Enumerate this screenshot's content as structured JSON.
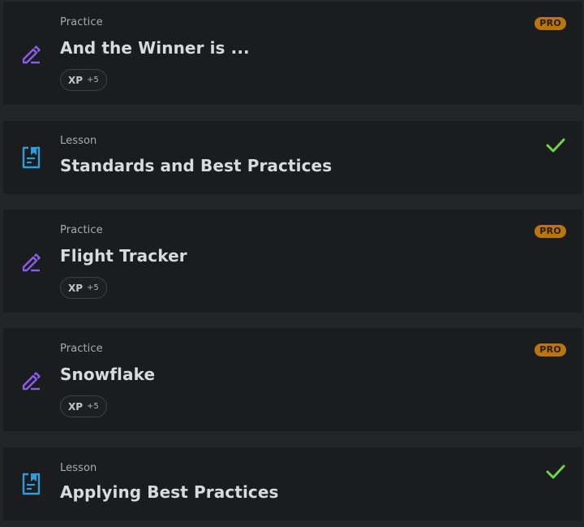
{
  "items": [
    {
      "type": "Practice",
      "title": "And the Winner is ...",
      "badge": "PRO",
      "xp_label": "XP",
      "xp_value": "+5",
      "icon": "pencil-icon"
    },
    {
      "type": "Lesson",
      "title": "Standards and Best Practices",
      "status": "completed",
      "icon": "lesson-document-icon"
    },
    {
      "type": "Practice",
      "title": "Flight Tracker",
      "badge": "PRO",
      "xp_label": "XP",
      "xp_value": "+5",
      "icon": "pencil-icon"
    },
    {
      "type": "Practice",
      "title": "Snowflake",
      "badge": "PRO",
      "xp_label": "XP",
      "xp_value": "+5",
      "icon": "pencil-icon"
    },
    {
      "type": "Lesson",
      "title": "Applying Best Practices",
      "status": "completed",
      "icon": "lesson-document-icon"
    }
  ],
  "colors": {
    "page_bg": "#232527",
    "card_bg": "#1b1c1e",
    "practice_icon": "#8a5cf0",
    "lesson_icon": "#2d9cdb",
    "pro_badge": "#b9760f",
    "check": "#6fd34f"
  }
}
